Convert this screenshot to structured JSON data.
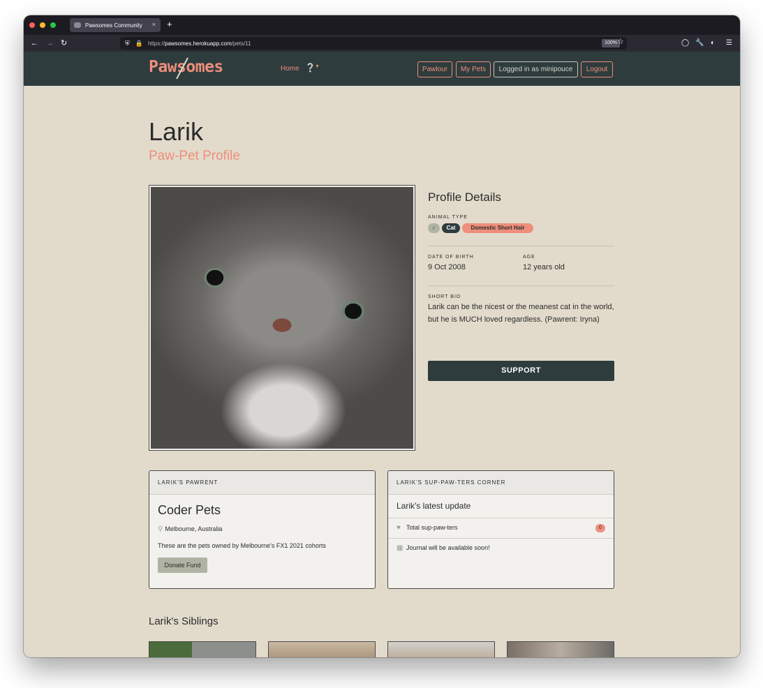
{
  "browser": {
    "tab_title": "Pawsomes Community",
    "tab_close": "×",
    "new_tab": "+",
    "url_prefix": "https://",
    "url_domain": "pawsomes.herokuapp.com",
    "url_path": "/pets/11",
    "zoom": "100%"
  },
  "site": {
    "logo": "Pawsomes",
    "nav": {
      "home": "Home",
      "help_icon": "?"
    },
    "header_buttons": {
      "pawlour": "Pawlour",
      "my_pets": "My Pets",
      "logged_in": "Logged in as minipouce",
      "logout": "Logout"
    }
  },
  "pet": {
    "name": "Larik",
    "subtitle": "Paw-Pet Profile",
    "details_title": "Profile Details",
    "animal_type_label": "ANIMAL TYPE",
    "sex_symbol": "♂",
    "type": "Cat",
    "breed": "Domestic Short Hair",
    "dob_label": "DATE OF BIRTH",
    "dob": "9 Oct 2008",
    "age_label": "AGE",
    "age": "12 years old",
    "bio_label": "SHORT BIO",
    "bio": "Larik can be the nicest or the meanest cat in the world, but he is MUCH loved regardless. (Pawrent: Iryna)",
    "support_button": "SUPPORT"
  },
  "pawrent_card": {
    "header": "LARIK'S PAWRENT",
    "title": "Coder Pets",
    "location": "Melbourne, Australia",
    "description": "These are the pets owned by Melbourne's FX1 2021 cohorts",
    "donate_button": "Donate Fund"
  },
  "supporters_card": {
    "header": "LARIK'S SUP-PAW-TERS CORNER",
    "title": "Larik's latest update",
    "total_label": "Total sup-paw-ters",
    "total_count": "0",
    "journal_note": "Journal will be available soon!"
  },
  "siblings": {
    "title": "Larik's Siblings"
  },
  "colors": {
    "accent": "#ef8e7c",
    "header_bg": "#2e3c3d",
    "page_bg": "#e2dbcb"
  }
}
